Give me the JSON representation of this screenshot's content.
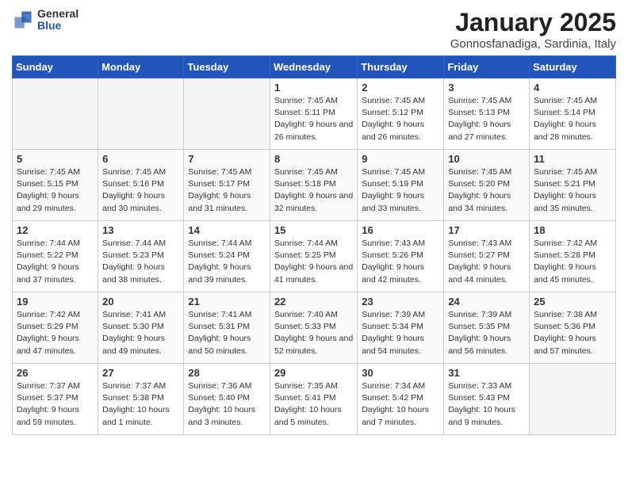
{
  "logo": {
    "general": "General",
    "blue": "Blue"
  },
  "title": "January 2025",
  "subtitle": "Gonnosfanadiga, Sardinia, Italy",
  "days_of_week": [
    "Sunday",
    "Monday",
    "Tuesday",
    "Wednesday",
    "Thursday",
    "Friday",
    "Saturday"
  ],
  "weeks": [
    [
      {
        "day": "",
        "info": ""
      },
      {
        "day": "",
        "info": ""
      },
      {
        "day": "",
        "info": ""
      },
      {
        "day": "1",
        "info": "Sunrise: 7:45 AM\nSunset: 5:11 PM\nDaylight: 9 hours and 26 minutes."
      },
      {
        "day": "2",
        "info": "Sunrise: 7:45 AM\nSunset: 5:12 PM\nDaylight: 9 hours and 26 minutes."
      },
      {
        "day": "3",
        "info": "Sunrise: 7:45 AM\nSunset: 5:13 PM\nDaylight: 9 hours and 27 minutes."
      },
      {
        "day": "4",
        "info": "Sunrise: 7:45 AM\nSunset: 5:14 PM\nDaylight: 9 hours and 28 minutes."
      }
    ],
    [
      {
        "day": "5",
        "info": "Sunrise: 7:45 AM\nSunset: 5:15 PM\nDaylight: 9 hours and 29 minutes."
      },
      {
        "day": "6",
        "info": "Sunrise: 7:45 AM\nSunset: 5:16 PM\nDaylight: 9 hours and 30 minutes."
      },
      {
        "day": "7",
        "info": "Sunrise: 7:45 AM\nSunset: 5:17 PM\nDaylight: 9 hours and 31 minutes."
      },
      {
        "day": "8",
        "info": "Sunrise: 7:45 AM\nSunset: 5:18 PM\nDaylight: 9 hours and 32 minutes."
      },
      {
        "day": "9",
        "info": "Sunrise: 7:45 AM\nSunset: 5:19 PM\nDaylight: 9 hours and 33 minutes."
      },
      {
        "day": "10",
        "info": "Sunrise: 7:45 AM\nSunset: 5:20 PM\nDaylight: 9 hours and 34 minutes."
      },
      {
        "day": "11",
        "info": "Sunrise: 7:45 AM\nSunset: 5:21 PM\nDaylight: 9 hours and 35 minutes."
      }
    ],
    [
      {
        "day": "12",
        "info": "Sunrise: 7:44 AM\nSunset: 5:22 PM\nDaylight: 9 hours and 37 minutes."
      },
      {
        "day": "13",
        "info": "Sunrise: 7:44 AM\nSunset: 5:23 PM\nDaylight: 9 hours and 38 minutes."
      },
      {
        "day": "14",
        "info": "Sunrise: 7:44 AM\nSunset: 5:24 PM\nDaylight: 9 hours and 39 minutes."
      },
      {
        "day": "15",
        "info": "Sunrise: 7:44 AM\nSunset: 5:25 PM\nDaylight: 9 hours and 41 minutes."
      },
      {
        "day": "16",
        "info": "Sunrise: 7:43 AM\nSunset: 5:26 PM\nDaylight: 9 hours and 42 minutes."
      },
      {
        "day": "17",
        "info": "Sunrise: 7:43 AM\nSunset: 5:27 PM\nDaylight: 9 hours and 44 minutes."
      },
      {
        "day": "18",
        "info": "Sunrise: 7:42 AM\nSunset: 5:28 PM\nDaylight: 9 hours and 45 minutes."
      }
    ],
    [
      {
        "day": "19",
        "info": "Sunrise: 7:42 AM\nSunset: 5:29 PM\nDaylight: 9 hours and 47 minutes."
      },
      {
        "day": "20",
        "info": "Sunrise: 7:41 AM\nSunset: 5:30 PM\nDaylight: 9 hours and 49 minutes."
      },
      {
        "day": "21",
        "info": "Sunrise: 7:41 AM\nSunset: 5:31 PM\nDaylight: 9 hours and 50 minutes."
      },
      {
        "day": "22",
        "info": "Sunrise: 7:40 AM\nSunset: 5:33 PM\nDaylight: 9 hours and 52 minutes."
      },
      {
        "day": "23",
        "info": "Sunrise: 7:39 AM\nSunset: 5:34 PM\nDaylight: 9 hours and 54 minutes."
      },
      {
        "day": "24",
        "info": "Sunrise: 7:39 AM\nSunset: 5:35 PM\nDaylight: 9 hours and 56 minutes."
      },
      {
        "day": "25",
        "info": "Sunrise: 7:38 AM\nSunset: 5:36 PM\nDaylight: 9 hours and 57 minutes."
      }
    ],
    [
      {
        "day": "26",
        "info": "Sunrise: 7:37 AM\nSunset: 5:37 PM\nDaylight: 9 hours and 59 minutes."
      },
      {
        "day": "27",
        "info": "Sunrise: 7:37 AM\nSunset: 5:38 PM\nDaylight: 10 hours and 1 minute."
      },
      {
        "day": "28",
        "info": "Sunrise: 7:36 AM\nSunset: 5:40 PM\nDaylight: 10 hours and 3 minutes."
      },
      {
        "day": "29",
        "info": "Sunrise: 7:35 AM\nSunset: 5:41 PM\nDaylight: 10 hours and 5 minutes."
      },
      {
        "day": "30",
        "info": "Sunrise: 7:34 AM\nSunset: 5:42 PM\nDaylight: 10 hours and 7 minutes."
      },
      {
        "day": "31",
        "info": "Sunrise: 7:33 AM\nSunset: 5:43 PM\nDaylight: 10 hours and 9 minutes."
      },
      {
        "day": "",
        "info": ""
      }
    ]
  ]
}
